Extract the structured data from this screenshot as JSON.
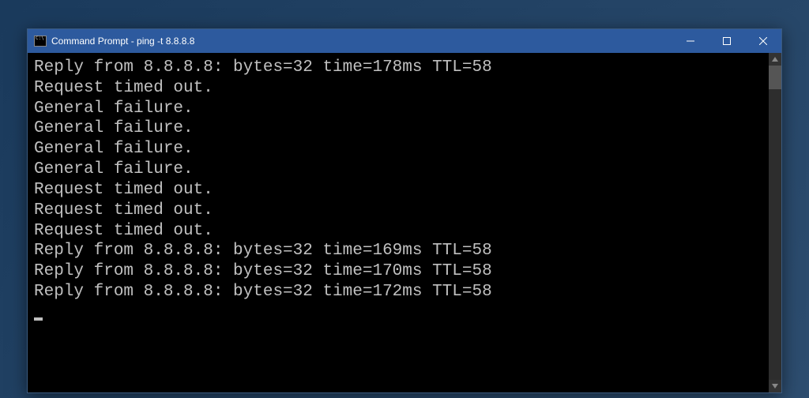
{
  "window": {
    "title": "Command Prompt - ping  -t 8.8.8.8"
  },
  "terminal": {
    "lines": [
      "Reply from 8.8.8.8: bytes=32 time=178ms TTL=58",
      "Request timed out.",
      "General failure.",
      "General failure.",
      "General failure.",
      "General failure.",
      "Request timed out.",
      "Request timed out.",
      "Request timed out.",
      "Reply from 8.8.8.8: bytes=32 time=169ms TTL=58",
      "Reply from 8.8.8.8: bytes=32 time=170ms TTL=58",
      "Reply from 8.8.8.8: bytes=32 time=172ms TTL=58"
    ]
  }
}
